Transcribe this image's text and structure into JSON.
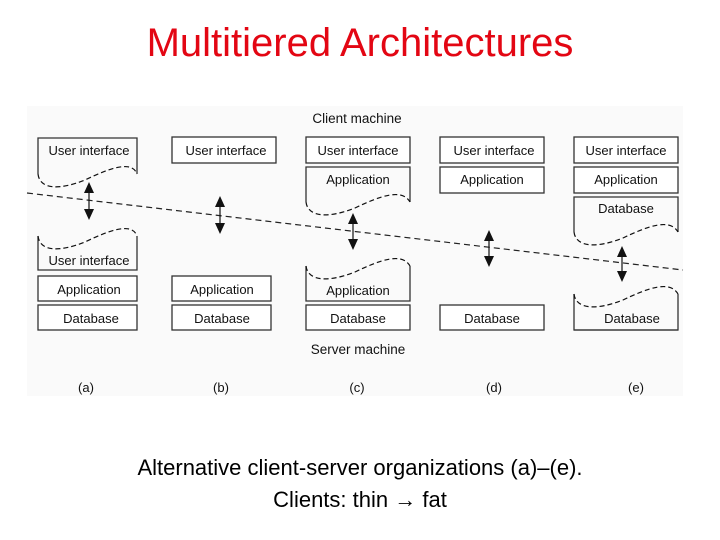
{
  "slide": {
    "title": "Multitiered Architectures",
    "caption_line1": "Alternative client-server organizations (a)–(e).",
    "caption_line2_prefix": "Clients: thin ",
    "caption_arrow": "→",
    "caption_line2_suffix": " fat",
    "title_color": "#e30613"
  },
  "diagram": {
    "client_label": "Client machine",
    "server_label": "Server machine",
    "columns": [
      {
        "id": "a",
        "label": "(a)",
        "client_tiers": [
          "User interface"
        ],
        "client_partial": "User interface",
        "server_partial": "User interface",
        "server_tiers": [
          "Application",
          "Database"
        ]
      },
      {
        "id": "b",
        "label": "(b)",
        "client_tiers": [
          "User interface"
        ],
        "client_partial": null,
        "server_partial": null,
        "server_tiers": [
          "Application",
          "Database"
        ]
      },
      {
        "id": "c",
        "label": "(c)",
        "client_tiers": [
          "User interface",
          "Application"
        ],
        "client_partial": "Application",
        "server_partial": "Application",
        "server_tiers": [
          "Application",
          "Database"
        ]
      },
      {
        "id": "d",
        "label": "(d)",
        "client_tiers": [
          "User interface",
          "Application"
        ],
        "client_partial": null,
        "server_partial": null,
        "server_tiers": [
          "Database"
        ]
      },
      {
        "id": "e",
        "label": "(e)",
        "client_tiers": [
          "User interface",
          "Application",
          "Database"
        ],
        "client_partial": "Database",
        "server_partial": "Database",
        "server_tiers": [
          "Database"
        ]
      }
    ]
  }
}
